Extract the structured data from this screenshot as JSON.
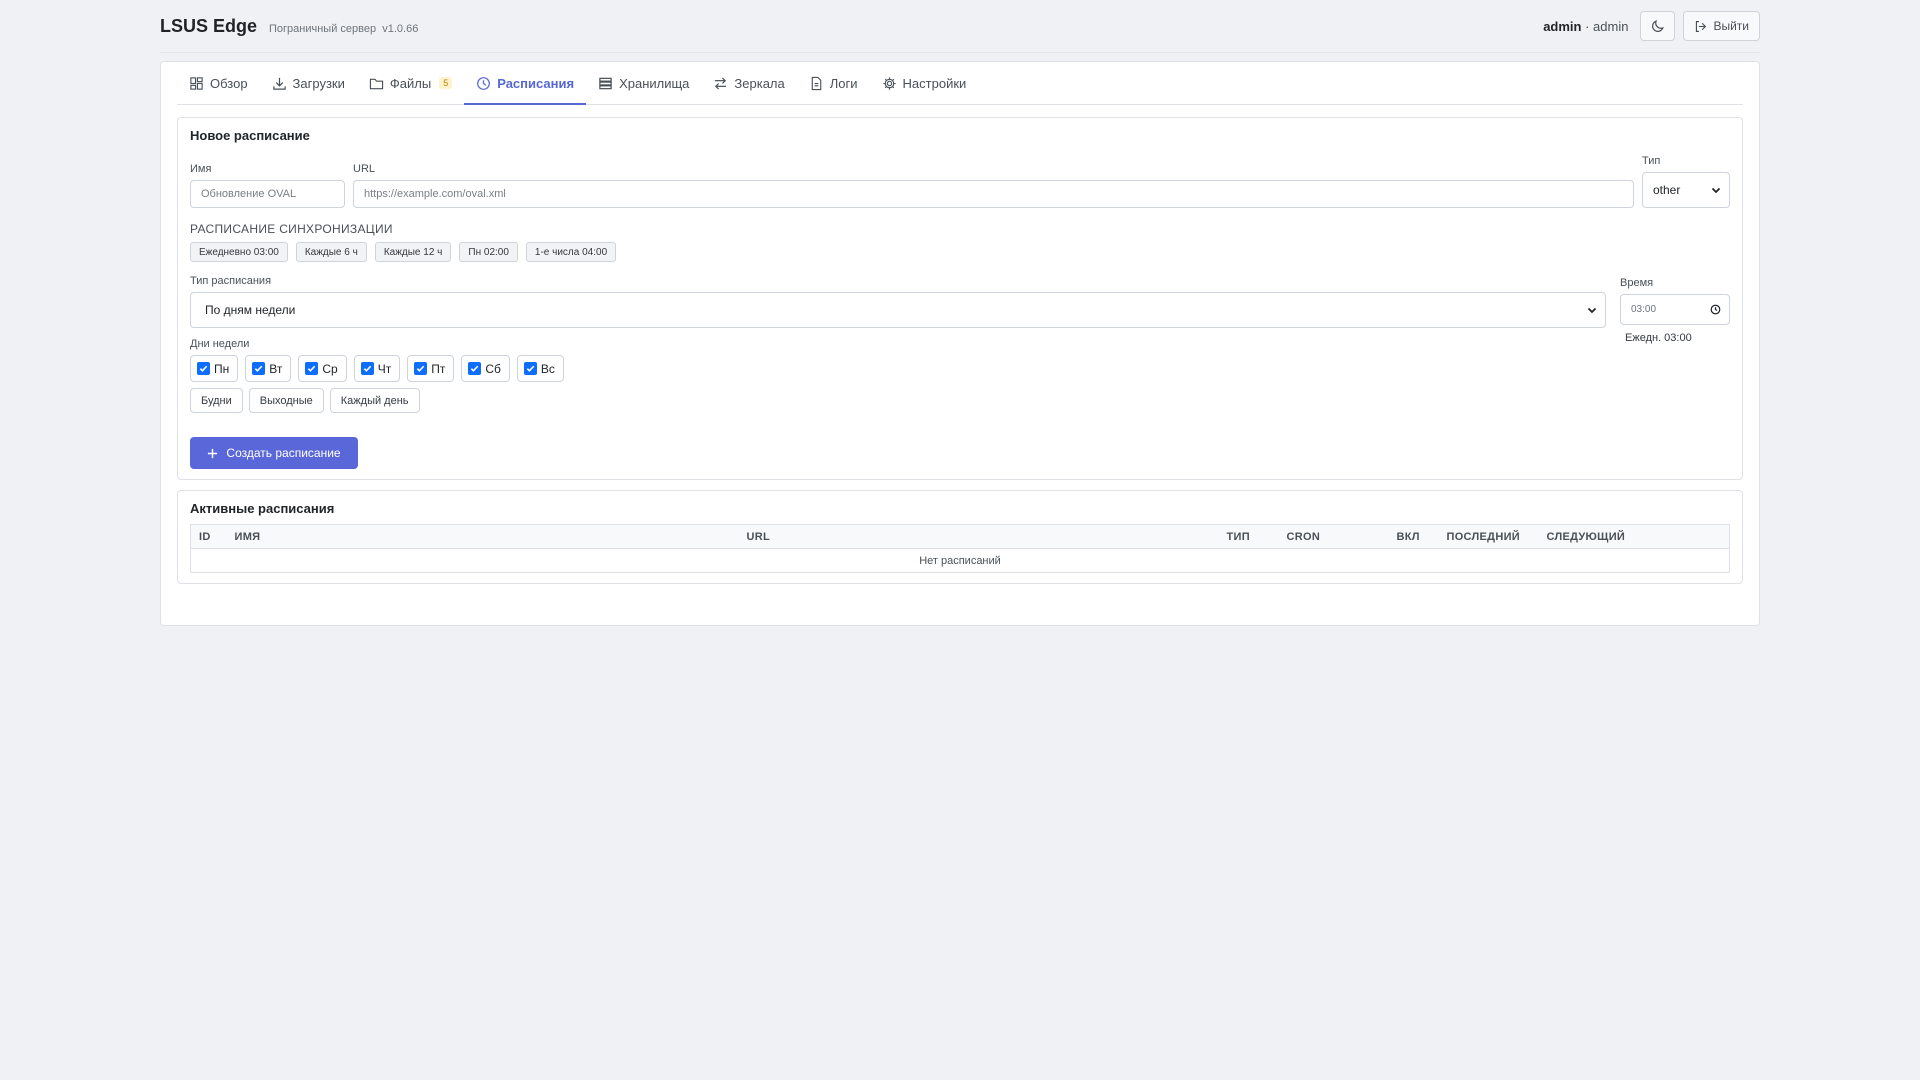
{
  "header": {
    "title": "LSUS Edge",
    "subtitle": "Пограничный сервер",
    "version": "v1.0.66",
    "user_name": "admin",
    "user_role": "admin",
    "logout_label": "Выйти"
  },
  "tabs": [
    {
      "label": "Обзор",
      "icon": "grid-icon"
    },
    {
      "label": "Загрузки",
      "icon": "download-icon"
    },
    {
      "label": "Файлы",
      "icon": "folder-icon",
      "badge": "5"
    },
    {
      "label": "Расписания",
      "icon": "clock-icon",
      "active": true
    },
    {
      "label": "Хранилища",
      "icon": "storage-icon"
    },
    {
      "label": "Зеркала",
      "icon": "arrows-icon"
    },
    {
      "label": "Логи",
      "icon": "file-icon"
    },
    {
      "label": "Настройки",
      "icon": "gear-icon"
    }
  ],
  "new_schedule": {
    "title": "Новое расписание",
    "name_label": "Имя",
    "name_placeholder": "Обновление OVAL",
    "url_label": "URL",
    "url_placeholder": "https://example.com/oval.xml",
    "type_label": "Тип",
    "type_value": "other",
    "sync_label": "РАСПИСАНИЕ СИНХРОНИЗАЦИИ",
    "presets": [
      "Ежедневно 03:00",
      "Каждые 6 ч",
      "Каждые 12 ч",
      "Пн 02:00",
      "1-е числа 04:00"
    ],
    "schedule_type_label": "Тип расписания",
    "schedule_type_value": "По дням недели",
    "time_label": "Время",
    "time_value": "03:00",
    "time_summary": "Ежедн. 03:00",
    "days_label": "Дни недели",
    "days": [
      {
        "label": "Пн",
        "checked": true
      },
      {
        "label": "Вт",
        "checked": true
      },
      {
        "label": "Ср",
        "checked": true
      },
      {
        "label": "Чт",
        "checked": true
      },
      {
        "label": "Пт",
        "checked": true
      },
      {
        "label": "Сб",
        "checked": true
      },
      {
        "label": "Вс",
        "checked": true
      }
    ],
    "quick_buttons": [
      "Будни",
      "Выходные",
      "Каждый день"
    ],
    "create_label": "Создать расписание"
  },
  "active_schedules": {
    "title": "Активные расписания",
    "columns": [
      "ID",
      "ИМЯ",
      "URL",
      "ТИП",
      "CRON",
      "ВКЛ",
      "ПОСЛЕДНИЙ",
      "СЛЕДУЮЩИЙ"
    ],
    "empty_text": "Нет расписаний"
  },
  "colors": {
    "accent": "#5468d4",
    "primary_button": "#5a67d8",
    "checkbox": "#0d6efd",
    "background": "#f0f1f5"
  }
}
